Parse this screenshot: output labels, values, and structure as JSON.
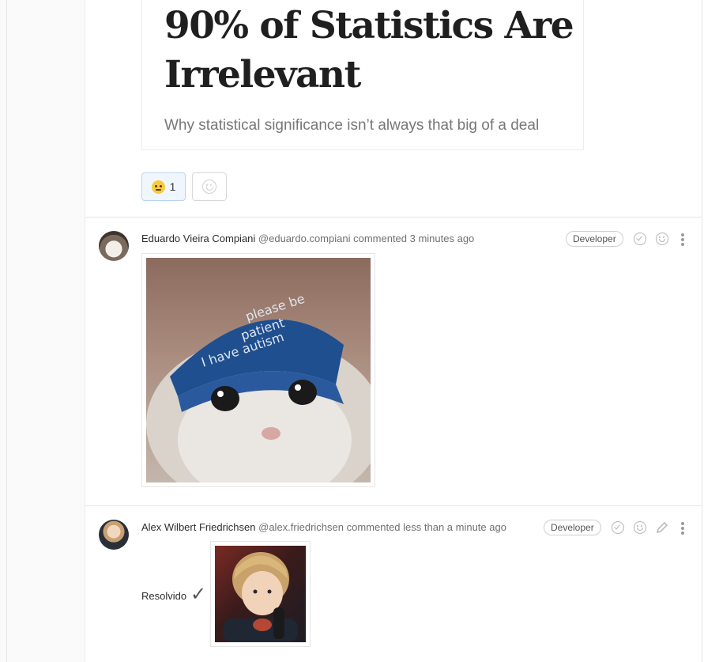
{
  "preview": {
    "title": "90% of Statistics Are Irrelevant",
    "subtitle": "Why statistical significance isn’t always that big of a deal"
  },
  "awards": {
    "thinking_count": "1"
  },
  "notes": [
    {
      "author": "Eduardo Vieira Compiani",
      "username": "@eduardo.compiani",
      "action_text": "commented 3 minutes ago",
      "role": "Developer",
      "image_caption": "please be patient I have autism"
    },
    {
      "author": "Alex Wilbert Friedrichsen",
      "username": "@alex.friedrichsen",
      "action_text": "commented less than a minute ago",
      "role": "Developer",
      "body_text": "Resolvido",
      "body_mark": "✓"
    }
  ],
  "colors": {
    "award_active_bg": "#f0f6fd",
    "award_active_border": "#b9d4f2",
    "divider": "#e5e5e5",
    "meta_text": "#707070"
  }
}
